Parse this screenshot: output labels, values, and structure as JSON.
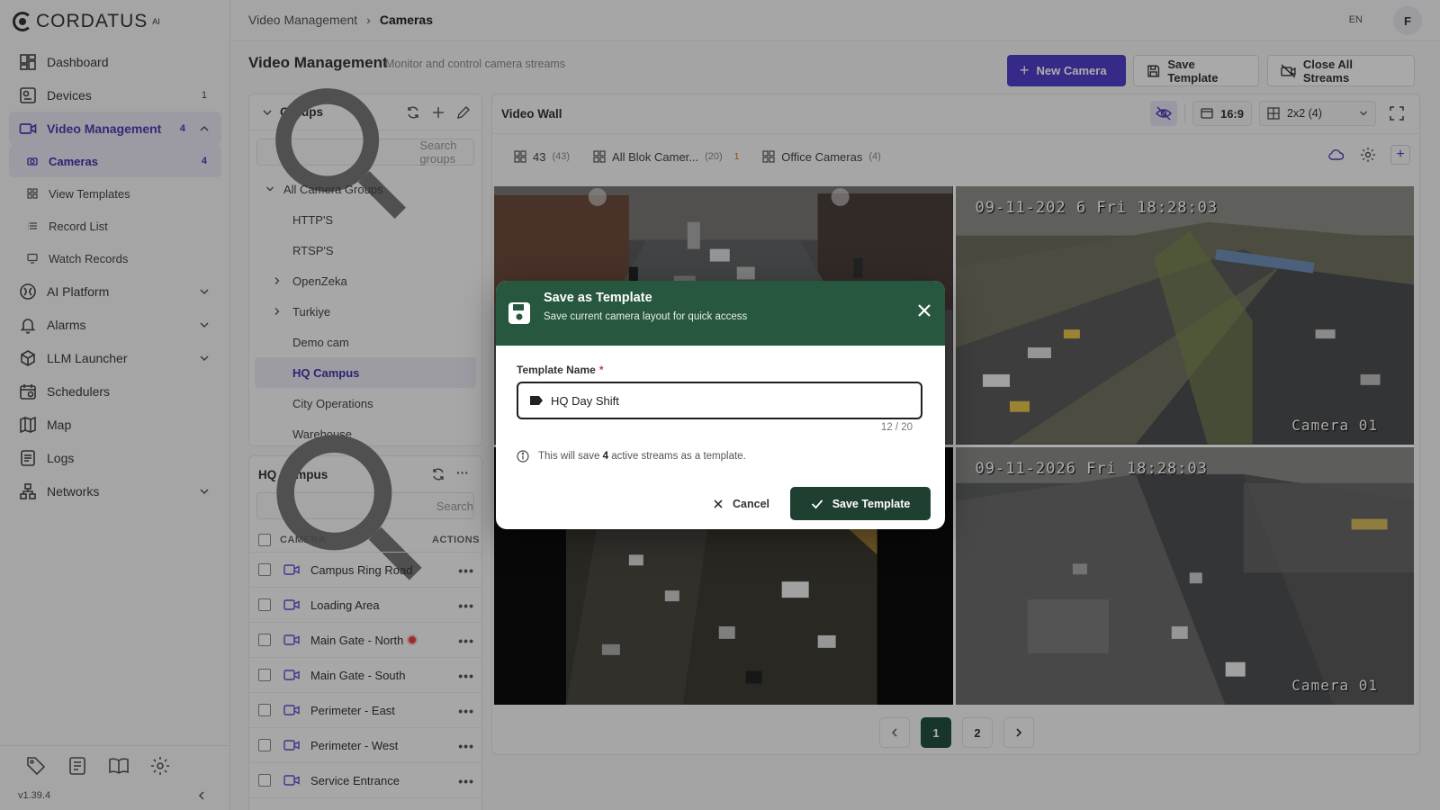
{
  "brand": {
    "name": "CORDATUS",
    "sup": "AI"
  },
  "sidebar": {
    "items": [
      {
        "label": "Dashboard",
        "icon": "dashboard-icon"
      },
      {
        "label": "Devices",
        "icon": "devices-icon",
        "badge": "1"
      },
      {
        "label": "Video Management",
        "icon": "video-camera-icon",
        "badge": "4",
        "expanded": true,
        "children": [
          {
            "label": "Cameras",
            "badge": "4",
            "active": true
          },
          {
            "label": "View Templates"
          },
          {
            "label": "Record List"
          },
          {
            "label": "Watch Records"
          }
        ]
      },
      {
        "label": "AI Platform",
        "icon": "ai-platform-icon",
        "chevron": true
      },
      {
        "label": "Alarms",
        "icon": "bell-icon",
        "chevron": true
      },
      {
        "label": "LLM Launcher",
        "icon": "cube-icon",
        "chevron": true
      },
      {
        "label": "Schedulers",
        "icon": "calendar-icon"
      },
      {
        "label": "Map",
        "icon": "map-icon"
      },
      {
        "label": "Logs",
        "icon": "logs-icon"
      },
      {
        "label": "Networks",
        "icon": "network-icon",
        "chevron": true
      }
    ],
    "version": "v1.39.4"
  },
  "topbar": {
    "breadcrumb": [
      "Video Management",
      "Cameras"
    ],
    "lang": "EN",
    "avatar": "F"
  },
  "header": {
    "title": "Video Management",
    "subtitle": "Monitor and control camera streams",
    "new_camera": "New Camera",
    "save_template": "Save Template",
    "close_all": "Close All Streams"
  },
  "groups": {
    "title": "Groups",
    "search_placeholder": "Search groups",
    "root": "All Camera Groups",
    "items": [
      {
        "label": "HTTP'S"
      },
      {
        "label": "RTSP'S"
      },
      {
        "label": "OpenZeka",
        "collapsible": true
      },
      {
        "label": "Turkiye",
        "collapsible": true
      },
      {
        "label": "Demo cam"
      },
      {
        "label": "HQ Campus",
        "selected": true
      },
      {
        "label": "City Operations"
      },
      {
        "label": "Warehouse"
      }
    ]
  },
  "cameras": {
    "title": "HQ Campus",
    "search_placeholder": "Search",
    "col_camera": "CAMERA",
    "col_actions": "ACTIONS",
    "rows": [
      {
        "name": "Campus Ring Road"
      },
      {
        "name": "Loading Area"
      },
      {
        "name": "Main Gate - North",
        "live": true
      },
      {
        "name": "Main Gate - South"
      },
      {
        "name": "Perimeter - East"
      },
      {
        "name": "Perimeter - West"
      },
      {
        "name": "Service Entrance"
      }
    ]
  },
  "wall": {
    "title": "Video Wall",
    "aspect": "16:9",
    "layout": "2x2 (4)",
    "tabs": [
      {
        "label": "43",
        "count": "(43)"
      },
      {
        "label": "All Blok Camer...",
        "count": "(20)",
        "warn": "1"
      },
      {
        "label": "Office Cameras",
        "count": "(4)"
      }
    ],
    "feeds": [
      {
        "ts": "",
        "label": ""
      },
      {
        "ts": "09-11-202 6 Fri 18:28:03",
        "label": "Camera 01"
      },
      {
        "ts": "",
        "label": ""
      },
      {
        "ts": "09-11-2026 Fri 18:28:03",
        "label": "Camera 01"
      }
    ],
    "pages": [
      "1",
      "2"
    ],
    "current_page": "1"
  },
  "modal": {
    "title": "Save as Template",
    "subtitle": "Save current camera layout for quick access",
    "field_label": "Template Name",
    "required_mark": "*",
    "value": "HQ Day Shift",
    "counter": "12 / 20",
    "note_pre": "This will save",
    "note_count": "4",
    "note_post": "active streams as a template.",
    "cancel": "Cancel",
    "save": "Save Template"
  },
  "colors": {
    "accent": "#4f3fc8",
    "modal_header": "#28573f",
    "save_button": "#1f3f31"
  }
}
